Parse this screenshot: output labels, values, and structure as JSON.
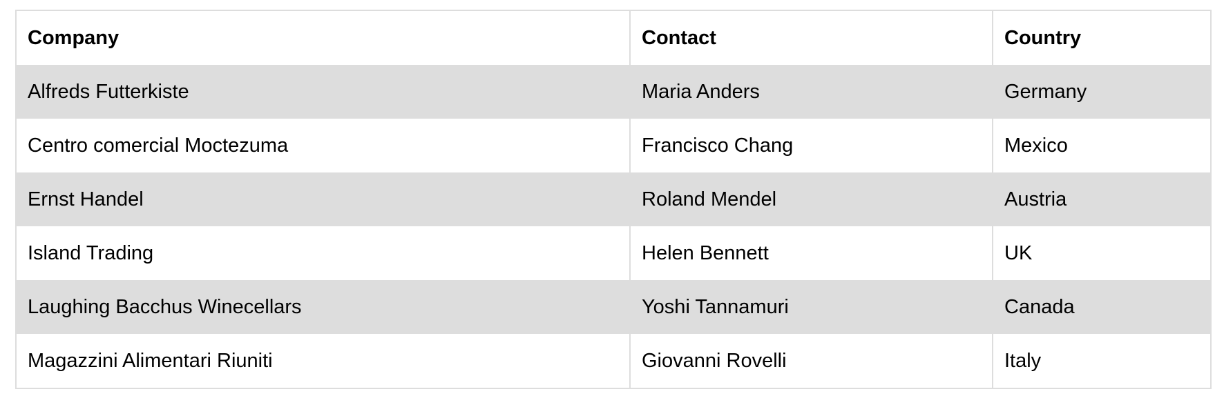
{
  "table": {
    "headers": [
      "Company",
      "Contact",
      "Country"
    ],
    "rows": [
      [
        "Alfreds Futterkiste",
        "Maria Anders",
        "Germany"
      ],
      [
        "Centro comercial Moctezuma",
        "Francisco Chang",
        "Mexico"
      ],
      [
        "Ernst Handel",
        "Roland Mendel",
        "Austria"
      ],
      [
        "Island Trading",
        "Helen Bennett",
        "UK"
      ],
      [
        "Laughing Bacchus Winecellars",
        "Yoshi Tannamuri",
        "Canada"
      ],
      [
        "Magazzini Alimentari Riuniti",
        "Giovanni Rovelli",
        "Italy"
      ]
    ]
  },
  "colors": {
    "stripe": "#dddddd",
    "border": "#dddddd",
    "background": "#ffffff",
    "text": "#000000"
  }
}
